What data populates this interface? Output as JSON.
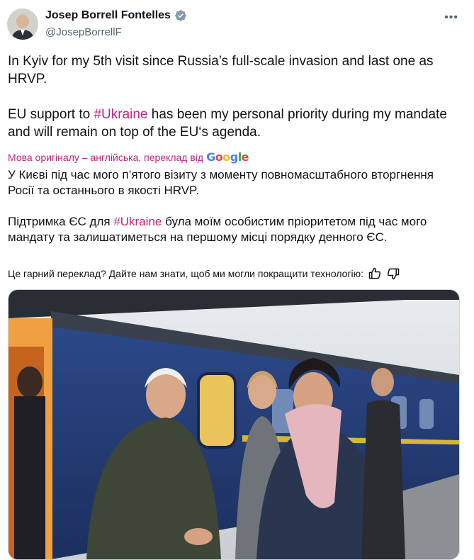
{
  "author": {
    "name": "Josep Borrell Fontelles",
    "handle": "@JosepBorrellF",
    "verified_icon": "verified-badge-icon",
    "avatar_icon": "avatar"
  },
  "menu": {
    "more_label": "•••"
  },
  "tweet": {
    "paragraph1": "In Kyiv for my 5th visit since Russia’s full-scale invasion and last one as HRVP.",
    "p2_before": "EU support to ",
    "p2_hashtag": "#Ukraine",
    "p2_after": " has been my personal priority during my mandate and will remain on top of the EU‘s agenda."
  },
  "translation_notice": {
    "label": "Мова оригіналу – англійська, переклад від",
    "provider": "Google"
  },
  "translation": {
    "paragraph1": "У Києві під час мого п’ятого візиту з моменту повномасштабного вторгнення Росії та останнього в якості HRVP.",
    "p2_before": "Підтримка ЄС для ",
    "p2_hashtag": "#Ukraine",
    "p2_after": " була моїм особистим пріоритетом під час мого мандату та залишатиметься на першому місці порядку денного ЄС."
  },
  "feedback": {
    "question": "Це гарний переклад? Дайте нам знати, щоб ми могли покращити технологію:"
  },
  "colors": {
    "hashtag": "#c0237f",
    "secondary_text": "#536471",
    "verified": "#829aab"
  }
}
